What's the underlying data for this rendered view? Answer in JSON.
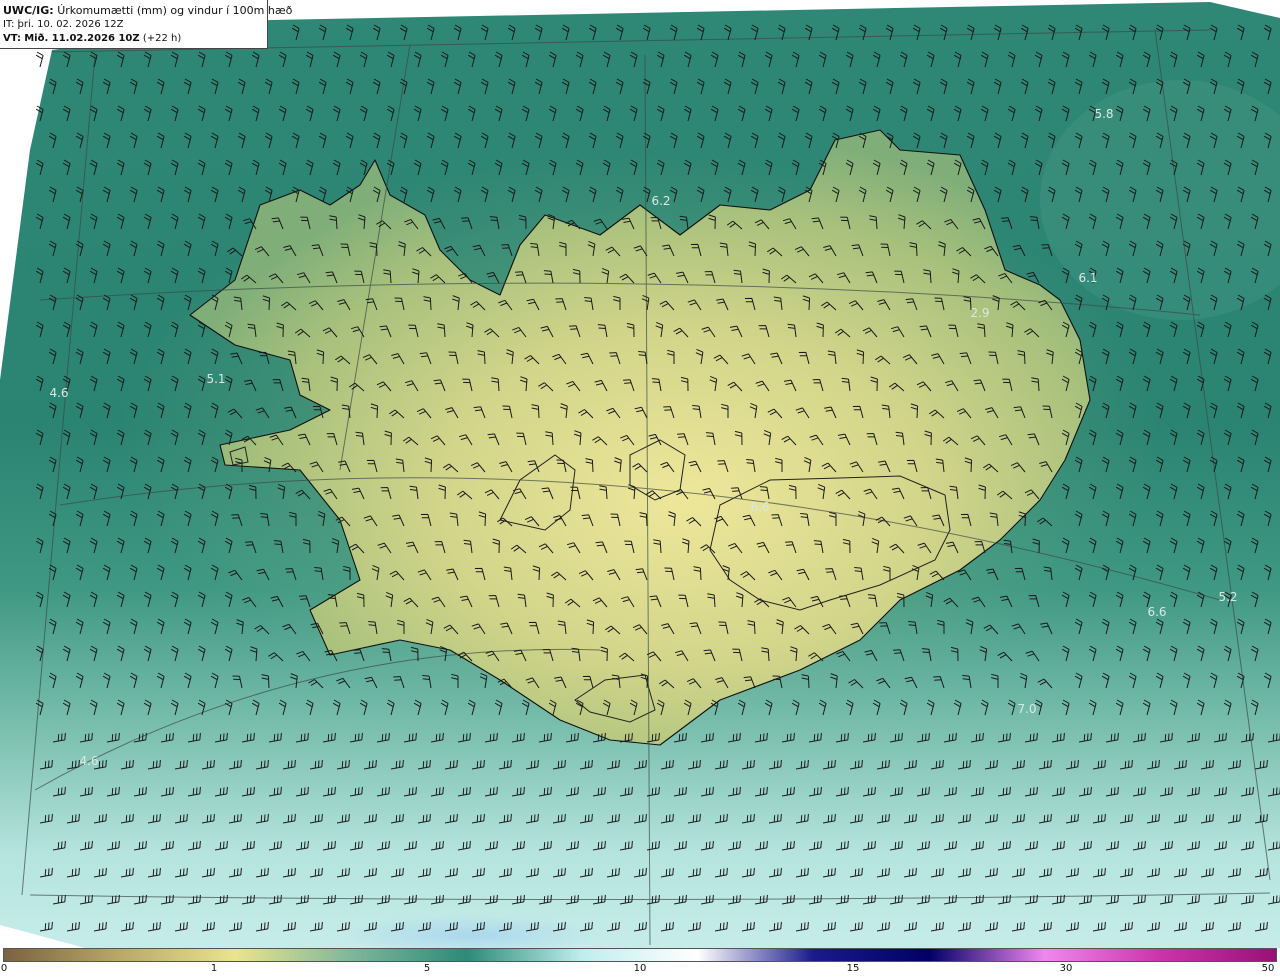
{
  "header": {
    "product": "UWC/IG:",
    "title": "Úrkomumætti (mm) og vindur í 100m hæð",
    "init_prefix": "IT:",
    "init_time": "þri. 10. 02. 2026 12Z",
    "valid_prefix": "VT:",
    "valid_time": "Mið. 11.02.2026 10Z",
    "lead": "(+22 h)"
  },
  "map_labels": [
    "5.8",
    "6.2",
    "6.1",
    "2.9",
    "4.6",
    "5.1",
    "6.6",
    "5.2",
    "6.6",
    "7.0",
    "4.6"
  ],
  "colorbar": {
    "ticks": [
      "0",
      "1",
      "5",
      "10",
      "15",
      "30",
      "50"
    ],
    "colors": [
      "#7a6240",
      "#b9a86a",
      "#e9e48f",
      "#7fb79a",
      "#2e8a78",
      "#bfeeee",
      "#ffffff",
      "#1a1a8c",
      "#000066",
      "#ee88ee",
      "#cc33aa",
      "#991177"
    ]
  }
}
